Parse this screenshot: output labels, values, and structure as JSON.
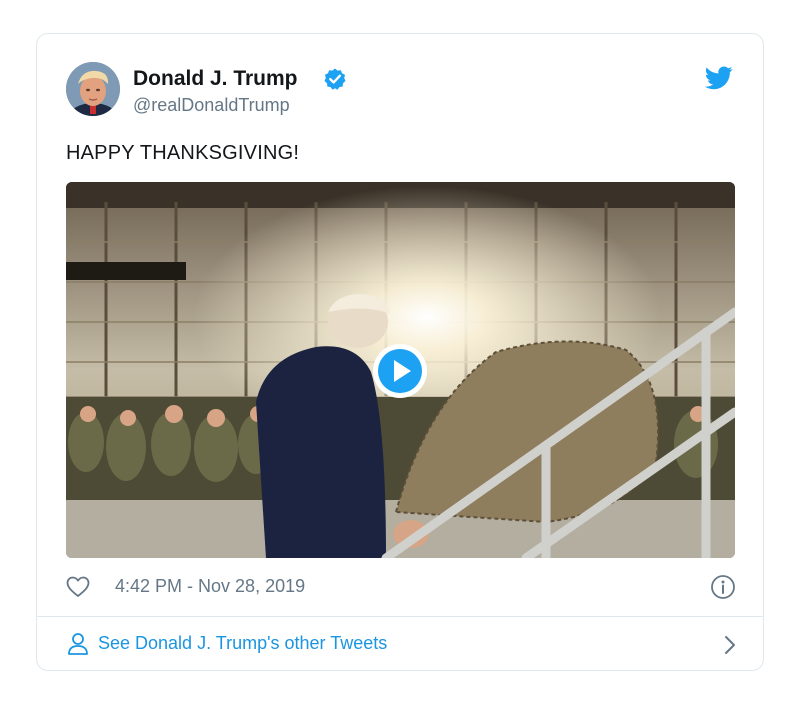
{
  "tweet": {
    "author": {
      "display_name": "Donald J. Trump",
      "handle": "@realDonaldTrump",
      "verified": true
    },
    "text": "HAPPY THANKSGIVING!",
    "timestamp": "4:42 PM - Nov 28, 2019"
  },
  "footer": {
    "link_label": "See Donald J. Trump's other Tweets"
  },
  "icons": {
    "brand": "twitter-bird-icon",
    "verified": "verified-badge-icon",
    "like": "heart-icon",
    "info": "info-icon",
    "profile": "person-icon",
    "chevron": "chevron-right-icon",
    "play": "play-icon"
  },
  "colors": {
    "brand_blue": "#1da1f2",
    "link_blue": "#1b95e0",
    "secondary_text": "#657786",
    "primary_text": "#14171a",
    "border": "#e1e8ed"
  }
}
